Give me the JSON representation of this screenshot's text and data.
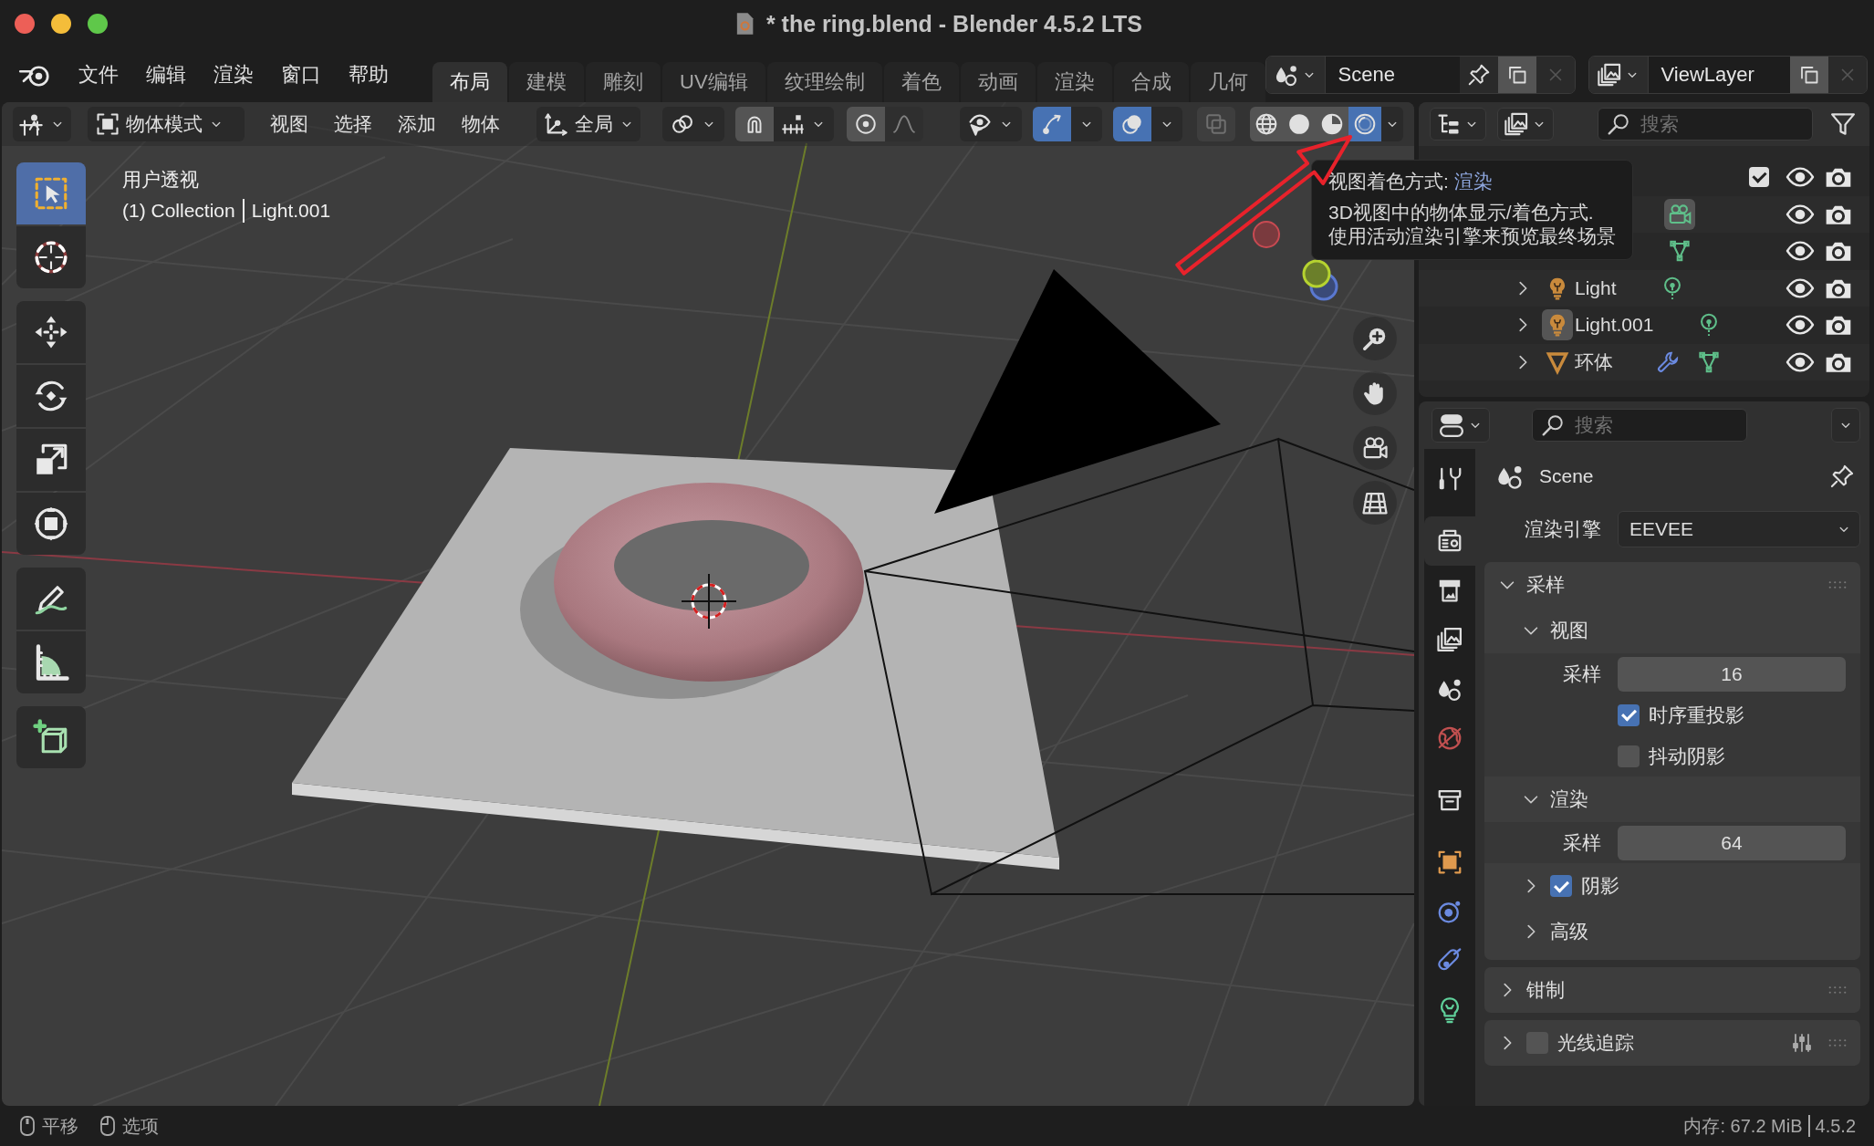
{
  "window": {
    "title": "* the ring.blend - Blender 4.5.2 LTS"
  },
  "menu": [
    "文件",
    "编辑",
    "渲染",
    "窗口",
    "帮助"
  ],
  "workspaces": [
    {
      "label": "布局",
      "selected": true
    },
    {
      "label": "建模",
      "selected": false
    },
    {
      "label": "雕刻",
      "selected": false
    },
    {
      "label": "UV编辑",
      "selected": false
    },
    {
      "label": "纹理绘制",
      "selected": false
    },
    {
      "label": "着色",
      "selected": false
    },
    {
      "label": "动画",
      "selected": false
    },
    {
      "label": "渲染",
      "selected": false
    },
    {
      "label": "合成",
      "selected": false
    },
    {
      "label": "几何",
      "selected": false
    }
  ],
  "scene": {
    "name": "Scene"
  },
  "view_layer": {
    "name": "ViewLayer"
  },
  "viewport": {
    "header": {
      "mode": "物体模式",
      "menus": [
        "视图",
        "选择",
        "添加",
        "物体"
      ],
      "orientation": "全局",
      "toggles": [
        {
          "kind": "snap",
          "on": false,
          "disabled": false
        },
        {
          "kind": "proportional",
          "on": false,
          "disabled": false
        },
        {
          "kind": "gizmo",
          "on": true,
          "disabled": false
        },
        {
          "kind": "overlay",
          "on": true,
          "disabled": false
        },
        {
          "kind": "xray",
          "on": false,
          "disabled": true
        }
      ],
      "shading": [
        {
          "kind": "wireframe",
          "selected": false
        },
        {
          "kind": "solid",
          "selected": false
        },
        {
          "kind": "material",
          "selected": false
        },
        {
          "kind": "rendered",
          "selected": true
        }
      ]
    },
    "view_name": "用户透视",
    "collection": "(1) Collection",
    "active_object": "Light.001",
    "tool_groups": [
      [
        {
          "kind": "select",
          "selected": true
        },
        {
          "kind": "cursor",
          "selected": false
        }
      ],
      [
        {
          "kind": "move",
          "selected": false
        },
        {
          "kind": "rotate",
          "selected": false
        },
        {
          "kind": "scale",
          "selected": false
        },
        {
          "kind": "transform",
          "selected": false
        }
      ],
      [
        {
          "kind": "annotate",
          "selected": false
        },
        {
          "kind": "measure",
          "selected": false
        }
      ],
      [
        {
          "kind": "add_cube",
          "selected": false
        }
      ]
    ]
  },
  "tooltip": {
    "title": "视图着色方式:",
    "value": "渲染",
    "lines": [
      "3D视图中的物体显示/着色方式.",
      "使用活动渲染引擎来预览最终场景"
    ]
  },
  "outliner": {
    "search_placeholder": "搜索",
    "rows": [
      {
        "checked": true,
        "children": [
          {
            "data": [
              {
                "kind": "camera",
                "active": true
              }
            ]
          },
          {
            "data": [
              {
                "kind": "mesh",
                "active": false
              }
            ]
          },
          {
            "kind": "light",
            "name": "Light",
            "expanded": false,
            "active": false,
            "data": [
              {
                "kind": "light",
                "active": false
              }
            ]
          },
          {
            "kind": "light",
            "name": "Light.001",
            "expanded": false,
            "active": true,
            "data": [
              {
                "kind": "light",
                "active": false
              }
            ]
          },
          {
            "kind": "mesh",
            "name": "环体",
            "expanded": false,
            "active": false,
            "data": [
              {
                "kind": "modifier",
                "active": false
              },
              {
                "kind": "mesh",
                "active": false
              }
            ]
          }
        ]
      }
    ]
  },
  "properties": {
    "search_placeholder": "搜索",
    "tabs": [
      {
        "kind": "tool",
        "selected": false
      },
      {
        "kind": "render",
        "selected": true
      },
      {
        "kind": "output",
        "selected": false
      },
      {
        "kind": "view_layer",
        "selected": false
      },
      {
        "kind": "scene",
        "selected": false
      },
      {
        "kind": "world",
        "selected": false
      },
      {
        "kind": "collection",
        "selected": false
      },
      {
        "kind": "object",
        "selected": false
      },
      {
        "kind": "physics",
        "selected": false
      },
      {
        "kind": "constraints",
        "selected": false
      },
      {
        "kind": "light",
        "selected": false
      }
    ],
    "context": "Scene",
    "engine_label": "渲染引擎",
    "engine": "EEVEE",
    "panels": [
      {
        "title": "采样",
        "expanded": true,
        "has_presets": false,
        "children": [
          {
            "title": "视图",
            "expanded": true,
            "items": [
              {
                "kind": "number",
                "label": "采样",
                "value": "16"
              },
              {
                "kind": "checkbox",
                "label": "时序重投影",
                "checked": true
              },
              {
                "kind": "checkbox",
                "label": "抖动阴影",
                "checked": false
              }
            ]
          },
          {
            "title": "渲染",
            "expanded": true,
            "items": [
              {
                "kind": "number",
                "label": "采样",
                "value": "64"
              }
            ]
          },
          {
            "title": "阴影",
            "expanded": false,
            "checked": true
          },
          {
            "title": "高级",
            "expanded": false
          }
        ]
      },
      {
        "title": "钳制",
        "expanded": false,
        "has_presets": false
      },
      {
        "title": "光线追踪",
        "expanded": false,
        "checked": false,
        "has_presets": true
      }
    ]
  },
  "status_bar": {
    "hints": [
      {
        "kind": "middle",
        "label": "平移"
      },
      {
        "kind": "right",
        "label": "选项"
      }
    ],
    "memory": "内存: 67.2 MiB",
    "version": "4.5.2"
  }
}
